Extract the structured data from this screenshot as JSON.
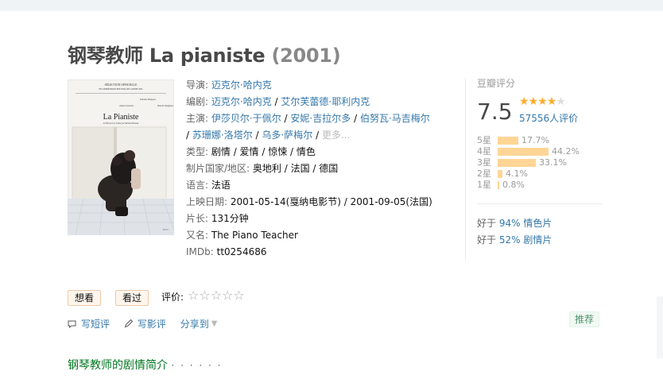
{
  "title": {
    "cn": "钢琴教师",
    "en": "La pianiste",
    "year": "(2001)"
  },
  "poster": {
    "top_text1": "SÉLECTION OFFICIELLE",
    "top_text2": "EN COMPÉTITION FESTIVAL DE CANNES 2001",
    "name1": "Isabelle Huppert",
    "name2": "Annie Girardot",
    "name3": "Benoît Magimel",
    "film": "La Pianiste",
    "credit": "un film écrit et réalisé par Michael Haneke"
  },
  "info": {
    "director_label": "导演:",
    "director": "迈克尔·哈内克",
    "writer_label": "编剧:",
    "writers": [
      "迈克尔·哈内克",
      "艾尔芙蕾德·耶利内克"
    ],
    "cast_label": "主演:",
    "cast_line1": [
      "伊莎贝尔·于佩尔",
      "安妮·吉拉尔多",
      "伯努瓦·马吉梅尔"
    ],
    "cast_line2": [
      "苏珊娜·洛塔尔",
      "乌多·萨梅尔"
    ],
    "more": "更多...",
    "genre_label": "类型:",
    "genres": "剧情 / 爱情 / 惊悚 / 情色",
    "country_label": "制片国家/地区:",
    "country": "奥地利 / 法国 / 德国",
    "language_label": "语言:",
    "language": "法语",
    "release_label": "上映日期:",
    "release": "2001-05-14(戛纳电影节) / 2001-09-05(法国)",
    "runtime_label": "片长:",
    "runtime": "131分钟",
    "aka_label": "又名:",
    "aka": "The Piano Teacher",
    "imdb_label": "IMDb:",
    "imdb": "tt0254686"
  },
  "rating": {
    "label": "豆瓣评分",
    "score": "7.5",
    "stars_value": 4,
    "stars_max": 5,
    "count": "57556人评价",
    "bars": [
      {
        "label": "5星",
        "pct": "17.7%",
        "value": 17.7
      },
      {
        "label": "4星",
        "pct": "44.2%",
        "value": 44.2
      },
      {
        "label": "3星",
        "pct": "33.1%",
        "value": 33.1
      },
      {
        "label": "2星",
        "pct": "4.1%",
        "value": 4.1
      },
      {
        "label": "1星",
        "pct": "0.8%",
        "value": 0.8
      }
    ],
    "better": [
      {
        "prefix": "好于",
        "pct": "94%",
        "cat": "情色片"
      },
      {
        "prefix": "好于",
        "pct": "52%",
        "cat": "剧情片"
      }
    ]
  },
  "buttons": {
    "want": "想看",
    "seen": "看过",
    "rate_label": "评价:"
  },
  "actions": {
    "short_review": "写短评",
    "review": "写影评",
    "share": "分享到",
    "recommend": "推荐"
  },
  "section": {
    "title": "钢琴教师的剧情简介",
    "dots": "· · · · · ·"
  },
  "colors": {
    "link": "#3377aa",
    "star": "#ffac2d",
    "bar": "#ffd596",
    "section": "#007722"
  }
}
